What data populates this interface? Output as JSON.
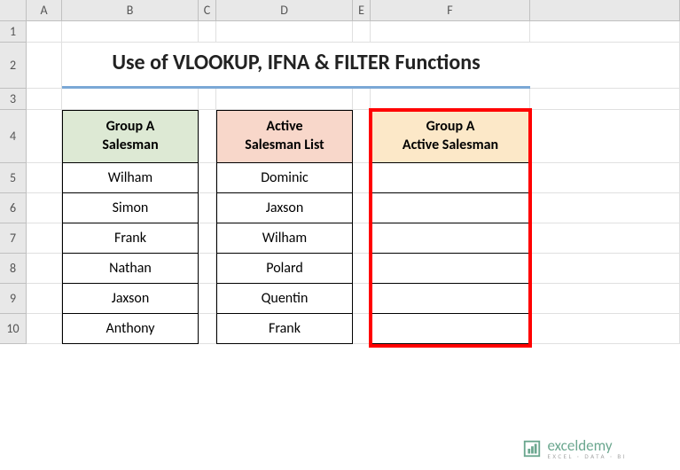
{
  "columns": [
    "A",
    "B",
    "C",
    "D",
    "E",
    "F"
  ],
  "rows": [
    "1",
    "2",
    "3",
    "4",
    "5",
    "6",
    "7",
    "8",
    "9",
    "10"
  ],
  "title": "Use of VLOOKUP, IFNA & FILTER Functions",
  "headers": {
    "b": "Group A\nSalesman",
    "d": "Active\nSalesman List",
    "f": "Group A\nActive Salesman"
  },
  "columnB": [
    "Wilham",
    "Simon",
    "Frank",
    "Nathan",
    "Jaxson",
    "Anthony"
  ],
  "columnD": [
    "Dominic",
    "Jaxson",
    "Wilham",
    "Polard",
    "Quentin",
    "Frank"
  ],
  "columnF": [
    "",
    "",
    "",
    "",
    "",
    ""
  ],
  "watermark": {
    "main": "exceldemy",
    "sub": "EXCEL · DATA · BI"
  },
  "chart_data": {
    "type": "table",
    "title": "Use of VLOOKUP, IFNA & FILTER Functions",
    "columns": [
      "Group A Salesman",
      "Active Salesman List",
      "Group A Active Salesman"
    ],
    "data": [
      [
        "Wilham",
        "Dominic",
        ""
      ],
      [
        "Simon",
        "Jaxson",
        ""
      ],
      [
        "Frank",
        "Wilham",
        ""
      ],
      [
        "Nathan",
        "Polard",
        ""
      ],
      [
        "Jaxson",
        "Quentin",
        ""
      ],
      [
        "Anthony",
        "Frank",
        ""
      ]
    ]
  }
}
